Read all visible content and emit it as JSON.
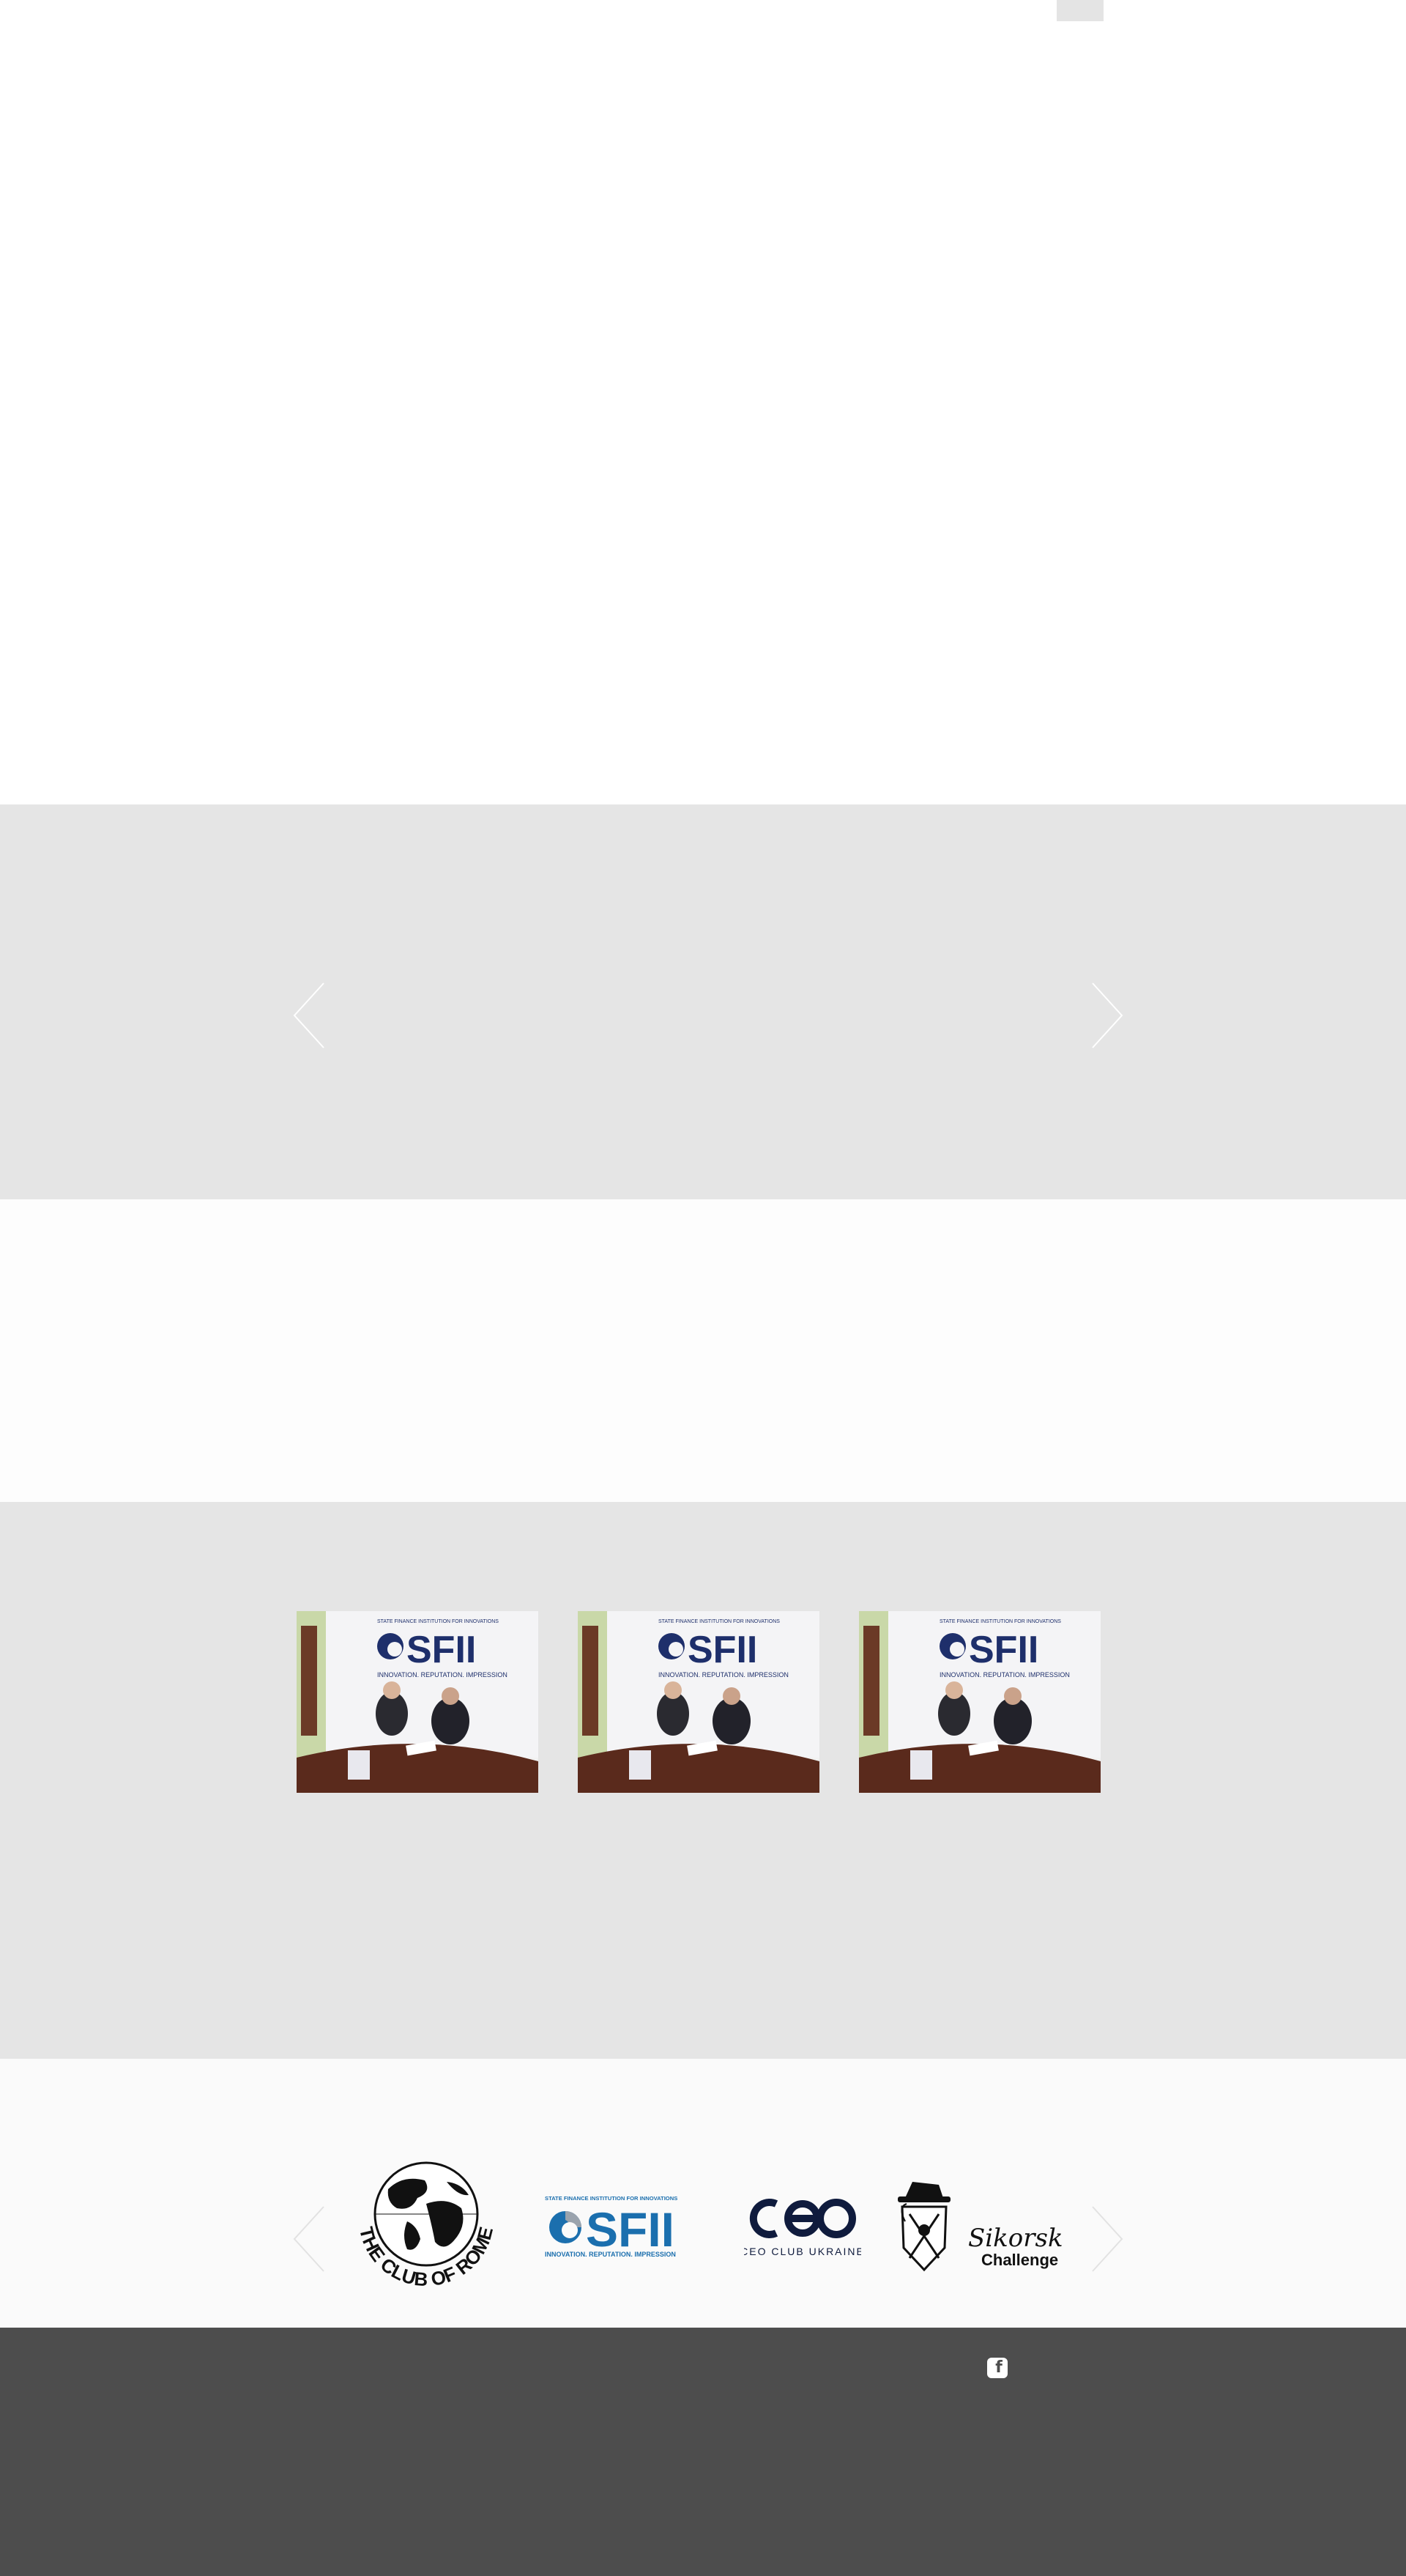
{
  "top": {
    "ui_element": "blank-top-area"
  },
  "slider": {
    "prev_icon": "chevron-left-icon",
    "next_icon": "chevron-right-icon"
  },
  "gallery": {
    "photos": [
      {
        "icon": "photo-signing-ceremony",
        "banner_text": "SFII",
        "banner_caption": "INNOVATION. REPUTATION. IMPRESSION",
        "banner_header": "STATE FINANCE INSTITUTION FOR INNOVATIONS"
      },
      {
        "icon": "photo-signing-ceremony",
        "banner_text": "SFII",
        "banner_caption": "INNOVATION. REPUTATION. IMPRESSION",
        "banner_header": "STATE FINANCE INSTITUTION FOR INNOVATIONS"
      },
      {
        "icon": "photo-signing-ceremony",
        "banner_text": "SFII",
        "banner_caption": "INNOVATION. REPUTATION. IMPRESSION",
        "banner_header": "STATE FINANCE INSTITUTION FOR INNOVATIONS"
      }
    ]
  },
  "partners": {
    "prev_icon": "chevron-left-icon",
    "next_icon": "chevron-right-icon",
    "club_of_rome": {
      "text": "THE CLUB OF ROME"
    },
    "sfii": {
      "header": "STATE FINANCE INSTITUTION FOR INNOVATIONS",
      "name": "SFII",
      "tagline": "INNOVATION. REPUTATION. IMPRESSION"
    },
    "ceo_club": {
      "mark": "ceo",
      "name": "CEO CLUB UKRAINE"
    },
    "sikorsky": {
      "line1": "Sikorsky",
      "line2": "Challenge"
    }
  },
  "footer": {
    "social_icon": "facebook-icon",
    "social_glyph": "f"
  },
  "colors": {
    "gray_band": "#e5e5e5",
    "footer": "#4d4d4d",
    "sfii_blue": "#1b6fae",
    "sfii_navy": "#1e2f6b",
    "ceo_navy": "#0f1b3d"
  }
}
